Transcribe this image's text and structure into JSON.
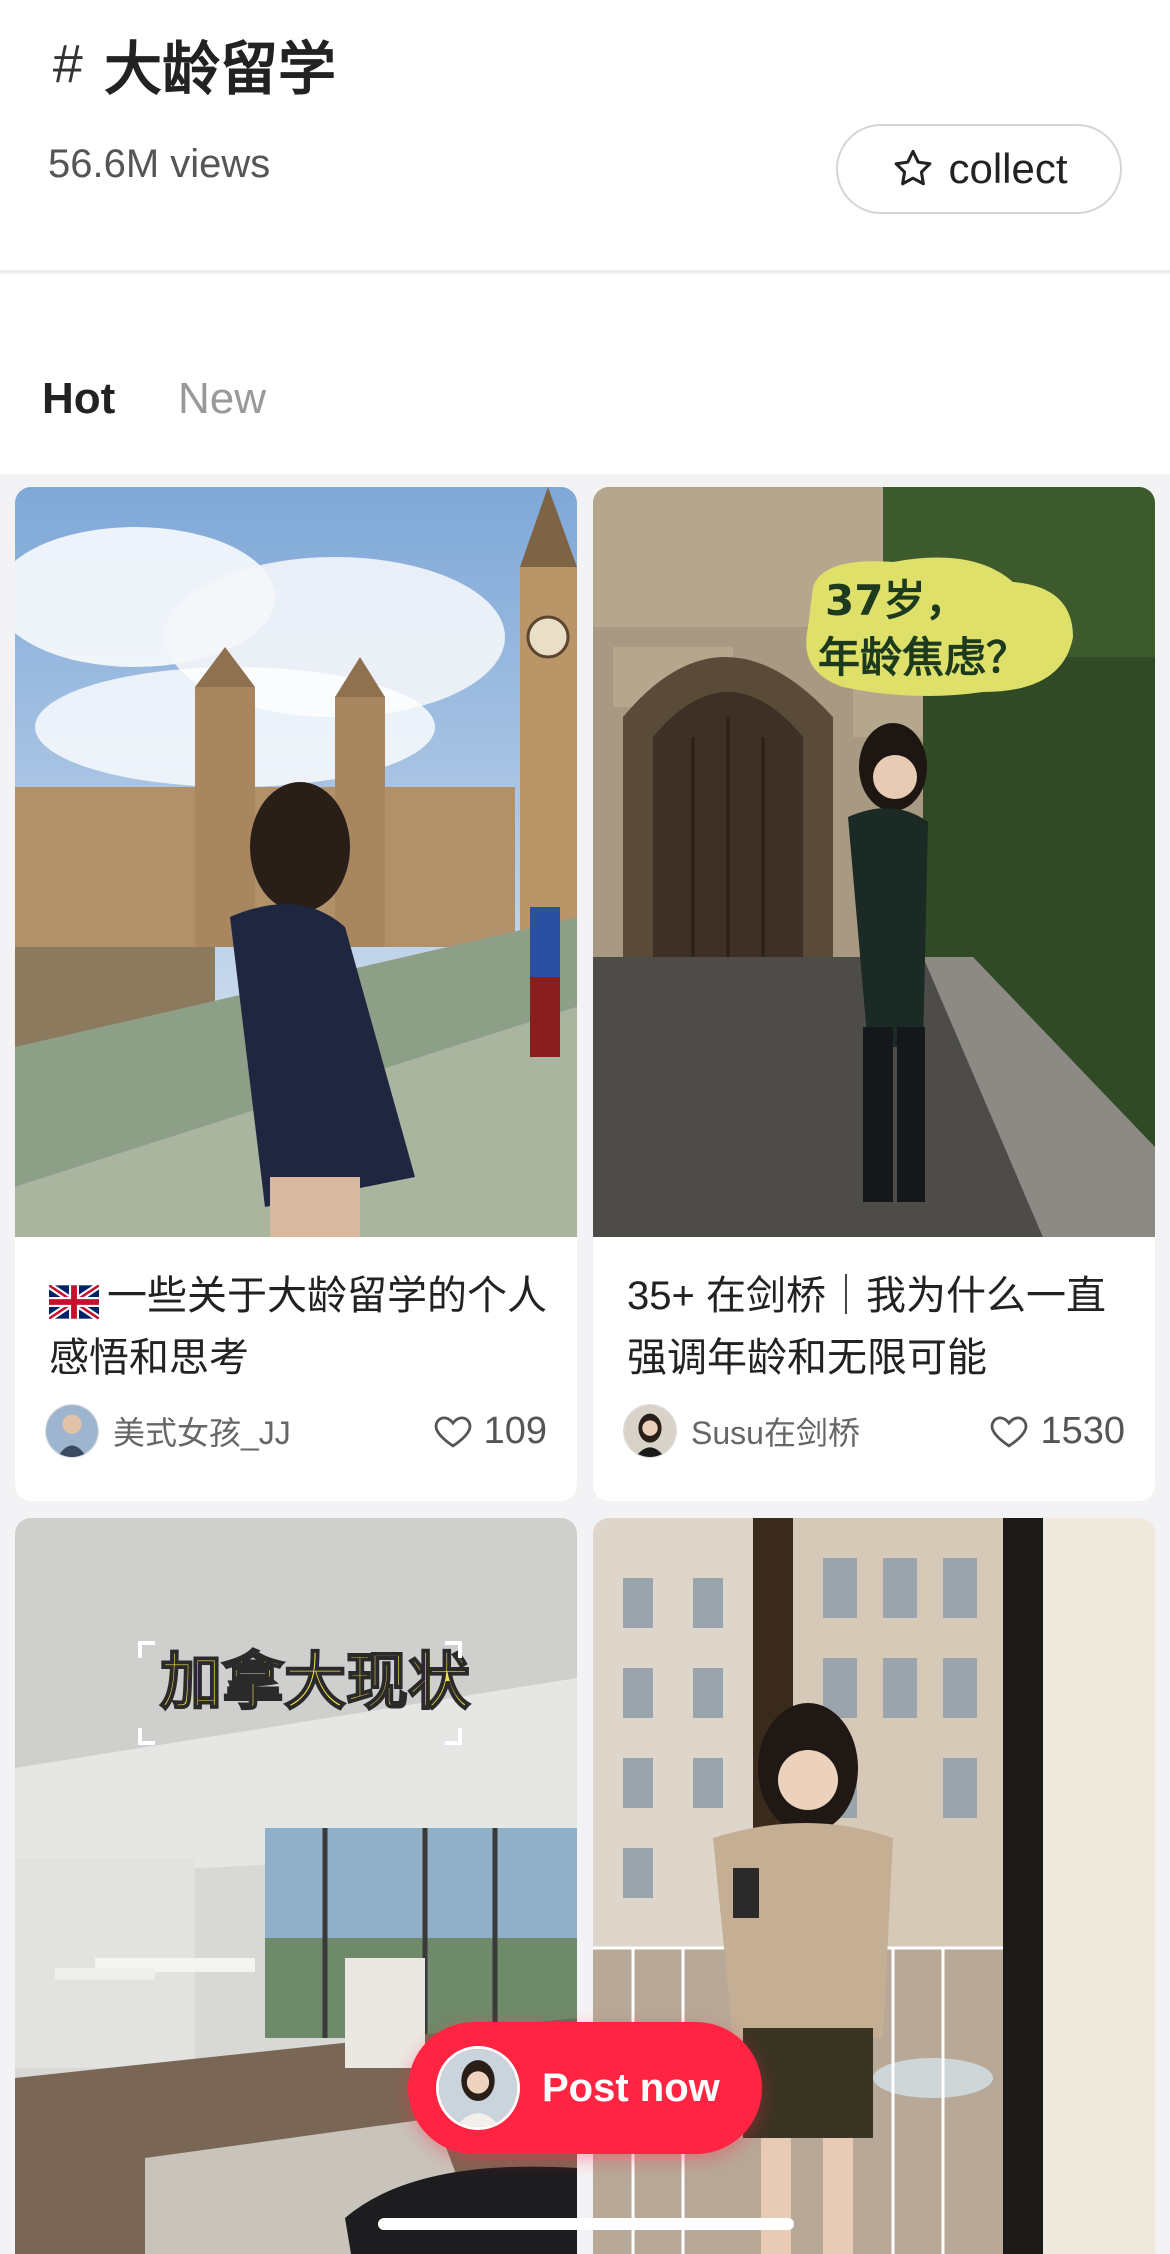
{
  "header": {
    "hash_symbol": "#",
    "tag_title": "大龄留学",
    "views": "56.6M views",
    "collect_label": "collect"
  },
  "tabs": [
    {
      "label": "Hot",
      "active": true
    },
    {
      "label": "New",
      "active": false
    }
  ],
  "cards": [
    {
      "title": "一些关于大龄留学的个人感悟和思考",
      "flag_icon": "uk-flag-emoji",
      "author": "美式女孩_JJ",
      "likes": "109"
    },
    {
      "title": "35+ 在剑桥｜我为什么一直强调年龄和无限可能",
      "image_text_line1": "37岁，",
      "image_text_line2": "年龄焦虑？",
      "author": "Susu在剑桥",
      "likes": "1530"
    },
    {
      "image_text": "加拿大现状"
    },
    {}
  ],
  "post_button": {
    "label": "Post now"
  },
  "colors": {
    "accent": "#ff2442",
    "text_primary": "#222222",
    "text_secondary": "#999999",
    "card_text_highlight": "#f5e24a"
  }
}
